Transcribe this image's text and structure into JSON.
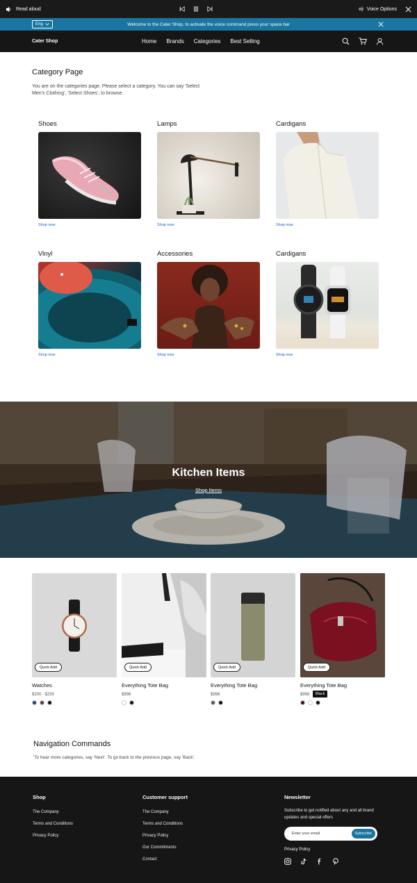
{
  "accessibility_bar": {
    "read_aloud": "Read aloud",
    "voice_options": "Voice Options"
  },
  "banner": {
    "language": "Eng",
    "message": "Welcome to the Cater Shop, to activate the voice command press your space bar"
  },
  "nav": {
    "brand": "Cater Shop",
    "links": [
      "Home",
      "Brands",
      "Categories",
      "Best Selling"
    ]
  },
  "page": {
    "title": "Category Page",
    "description": "You are on the categories page. Please select a category. You can say 'Select Men's Clothing', 'Select Shoes', to browse."
  },
  "categories": [
    {
      "title": "Shoes",
      "link": "Shop now"
    },
    {
      "title": "Lamps",
      "link": "Shop now"
    },
    {
      "title": "Cardigans",
      "link": "Shop now"
    },
    {
      "title": "Vinyl",
      "link": "Shop now"
    },
    {
      "title": "Accessories",
      "link": "Shop now"
    },
    {
      "title": "Cardigans",
      "link": "Shop now"
    }
  ],
  "hero": {
    "title": "Kitchen Items",
    "link": "Shop Items"
  },
  "products": [
    {
      "name": "Watches",
      "price": "$200 - $250",
      "quick_add": "Quick Add",
      "swatches": [
        "#27407e",
        "#6b3a3a",
        "#111111"
      ]
    },
    {
      "name": "Everything Tote Bag",
      "price": "$998",
      "quick_add": "Quick Add",
      "swatches": [
        "#ffffff",
        "#111111"
      ]
    },
    {
      "name": "Everything Tote Bag",
      "price": "$998",
      "quick_add": "Quick Add",
      "swatches": [
        "#5a5a42",
        "#111111"
      ]
    },
    {
      "name": "Everything Tote Bag",
      "price": "$998",
      "quick_add": "Quick Add",
      "swatches": [
        "#4a0a0a",
        "#ffffff",
        "#111111"
      ],
      "tooltip": "Black"
    }
  ],
  "nav_commands": {
    "title": "Navigation Commands",
    "text": "'To hear more categories, say 'Next'. To go back to the previous page, say 'Back'."
  },
  "footer": {
    "shop": {
      "title": "Shop",
      "items": [
        "The Company",
        "Terms and Conditions",
        "Privacy Policy"
      ]
    },
    "support": {
      "title": "Customer support",
      "items": [
        "The Company",
        "Terms and Conditions",
        "Privacy Policy",
        "Our Commitments",
        "Contact"
      ]
    },
    "newsletter": {
      "title": "Newsletter",
      "text": "Subscribe to get notified about any and all brand updates and special offers",
      "placeholder": "Enter your email",
      "button": "Subscribe",
      "privacy": "Privacy Policy"
    }
  },
  "colors": {
    "accent": "#1a76a0",
    "dark": "#161616",
    "link": "#1a5bd0"
  }
}
